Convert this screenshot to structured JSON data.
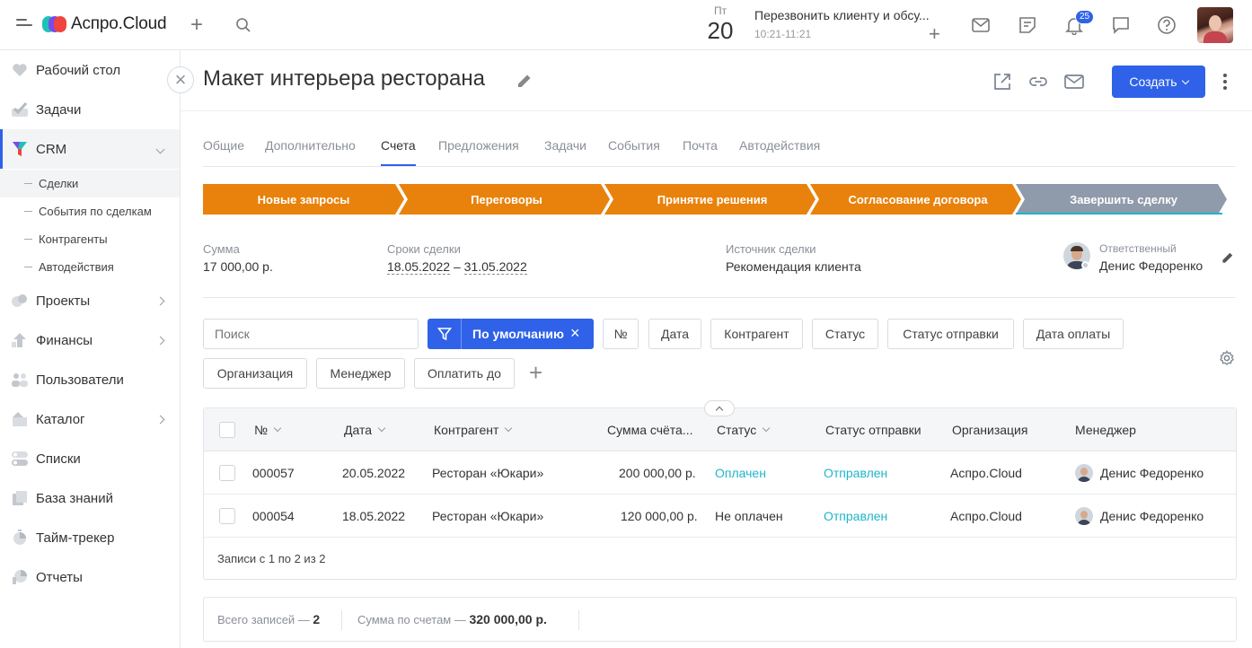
{
  "topbar": {
    "logo_text": "Аспро.Cloud",
    "calendar": {
      "dow": "Пт",
      "day": "20"
    },
    "event": {
      "title": "Перезвонить клиенту и обсу...",
      "time": "10:21-11:21"
    },
    "notifications_count": "25"
  },
  "sidebar": {
    "items": [
      {
        "label": "Рабочий стол",
        "icon": "heart-icon"
      },
      {
        "label": "Задачи",
        "icon": "check-icon"
      },
      {
        "label": "CRM",
        "icon": "crm-funnel-icon"
      },
      {
        "label": "Проекты",
        "icon": "projects-icon"
      },
      {
        "label": "Финансы",
        "icon": "finance-icon"
      },
      {
        "label": "Пользователи",
        "icon": "users-icon"
      },
      {
        "label": "Каталог",
        "icon": "catalog-icon"
      },
      {
        "label": "Списки",
        "icon": "lists-icon"
      },
      {
        "label": "База знаний",
        "icon": "knowledge-icon"
      },
      {
        "label": "Тайм-трекер",
        "icon": "timer-icon"
      },
      {
        "label": "Отчеты",
        "icon": "reports-icon"
      }
    ],
    "crm_sub": [
      "Сделки",
      "События по сделкам",
      "Контрагенты",
      "Автодействия"
    ]
  },
  "page": {
    "title": "Макет интерьера ресторана",
    "create_label": "Создать"
  },
  "tabs": [
    "Общие",
    "Дополнительно",
    "Счета",
    "Предложения",
    "Задачи",
    "События",
    "Почта",
    "Автодействия"
  ],
  "active_tab": "Счета",
  "stages": [
    "Новые запросы",
    "Переговоры",
    "Принятие решения",
    "Согласование договора",
    "Завершить сделку"
  ],
  "colors": {
    "accent": "#2f62e8",
    "stage_active": "#e8820c",
    "stage_final": "#8f9aab",
    "link": "#1fb5c9"
  },
  "deal": {
    "sum_label": "Сумма",
    "sum_value": "17 000,00 р.",
    "dates_label": "Сроки сделки",
    "date_from": "18.05.2022",
    "date_sep": "–",
    "date_to": "31.05.2022",
    "source_label": "Источник сделки",
    "source_value": "Рекомендация клиента",
    "resp_label": "Ответственный",
    "resp_value": "Денис Федоренко"
  },
  "filters": {
    "search_placeholder": "Поиск",
    "preset": "По умолчанию",
    "chips": [
      "№",
      "Дата",
      "Контрагент",
      "Статус",
      "Статус отправки",
      "Дата оплаты",
      "Организация",
      "Менеджер",
      "Оплатить до"
    ]
  },
  "table": {
    "headers": [
      "№",
      "Дата",
      "Контрагент",
      "Сумма счёта...",
      "Статус",
      "Статус отправки",
      "Организация",
      "Менеджер"
    ],
    "rows": [
      {
        "num": "000057",
        "date": "20.05.2022",
        "counterparty": "Ресторан «Юкари»",
        "sum": "200 000,00 р.",
        "status": "Оплачен",
        "send_status": "Отправлен",
        "org": "Аспро.Cloud",
        "manager": "Денис Федоренко"
      },
      {
        "num": "000054",
        "date": "18.05.2022",
        "counterparty": "Ресторан «Юкари»",
        "sum": "120 000,00 р.",
        "status": "Не оплачен",
        "send_status": "Отправлен",
        "org": "Аспро.Cloud",
        "manager": "Денис Федоренко"
      }
    ],
    "footer": "Записи с 1 по 2 из 2"
  },
  "summary": {
    "total_label": "Всего записей —",
    "total_value": "2",
    "sum_label": "Сумма по счетам —",
    "sum_value": "320 000,00 р."
  }
}
